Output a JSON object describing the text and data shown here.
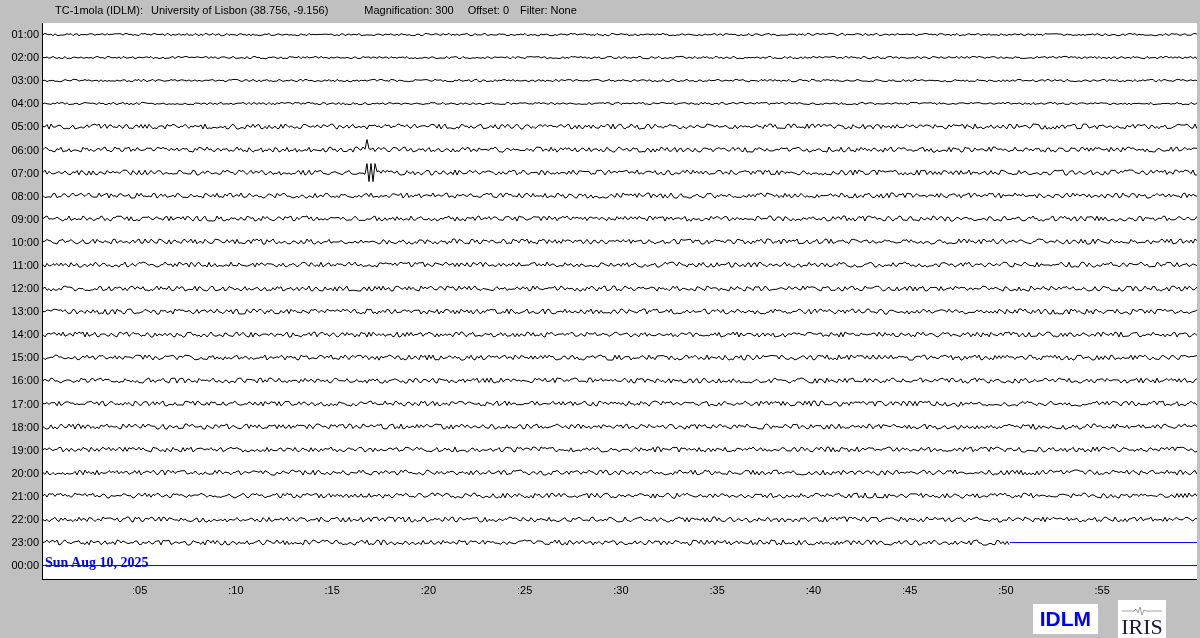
{
  "header": {
    "station": "TC-1mola (IDLM):",
    "location": "University of Lisbon (38.756, -9.156)",
    "magnification": "Magnification: 300",
    "offset": "Offset: 0",
    "filter": "Filter: None"
  },
  "rows": [
    {
      "time": "01:00",
      "kind": "trace"
    },
    {
      "time": "02:00",
      "kind": "trace"
    },
    {
      "time": "03:00",
      "kind": "trace"
    },
    {
      "time": "04:00",
      "kind": "trace"
    },
    {
      "time": "05:00",
      "kind": "trace"
    },
    {
      "time": "06:00",
      "kind": "trace"
    },
    {
      "time": "07:00",
      "kind": "trace"
    },
    {
      "time": "08:00",
      "kind": "trace"
    },
    {
      "time": "09:00",
      "kind": "trace"
    },
    {
      "time": "10:00",
      "kind": "trace"
    },
    {
      "time": "11:00",
      "kind": "trace"
    },
    {
      "time": "12:00",
      "kind": "trace"
    },
    {
      "time": "13:00",
      "kind": "trace"
    },
    {
      "time": "14:00",
      "kind": "trace"
    },
    {
      "time": "15:00",
      "kind": "trace"
    },
    {
      "time": "16:00",
      "kind": "trace"
    },
    {
      "time": "17:00",
      "kind": "trace"
    },
    {
      "time": "18:00",
      "kind": "trace"
    },
    {
      "time": "19:00",
      "kind": "trace"
    },
    {
      "time": "20:00",
      "kind": "trace"
    },
    {
      "time": "21:00",
      "kind": "trace"
    },
    {
      "time": "22:00",
      "kind": "trace"
    },
    {
      "time": "23:00",
      "kind": "partial"
    },
    {
      "time": "00:00",
      "kind": "pending",
      "date": "Sun Aug 10, 2025"
    }
  ],
  "x_ticks": [
    ":05",
    ":10",
    ":15",
    ":20",
    ":25",
    ":30",
    ":35",
    ":40",
    ":45",
    ":50",
    ":55"
  ],
  "logos": {
    "station": "IDLM",
    "network": "IRIS"
  }
}
